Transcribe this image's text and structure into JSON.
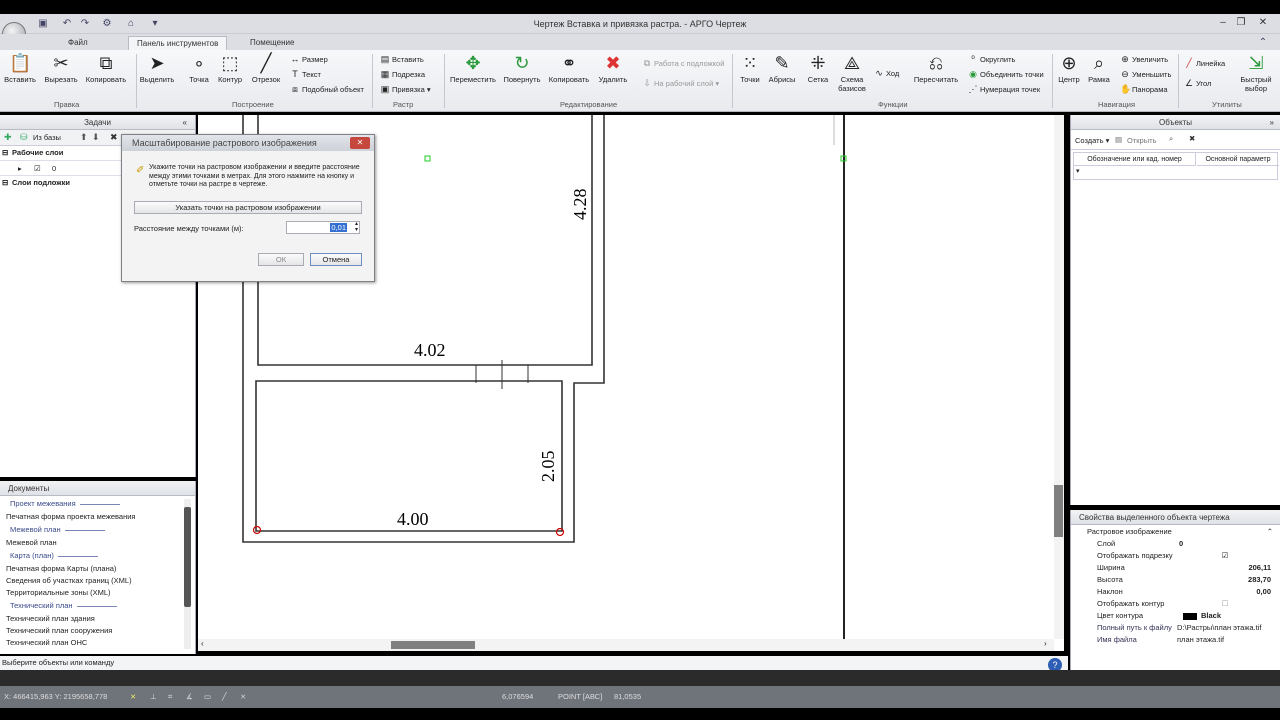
{
  "window": {
    "title": "Чертеж Вставка и привязка растра. - АРГО Чертеж"
  },
  "tabs": [
    {
      "label": "Файл"
    },
    {
      "label": "Панель инструментов"
    },
    {
      "label": "Помещение"
    }
  ],
  "ribbon": {
    "pravka": {
      "label": "Правка",
      "paste": "Вставить",
      "cut": "Вырезать",
      "copy": "Копировать"
    },
    "postroenie": {
      "label": "Построение",
      "select": "Выделить",
      "point": "Точка",
      "contour": "Контур",
      "segment": "Отрезок",
      "size": "Размер",
      "text": "Текст",
      "similar": "Подобный объект"
    },
    "raster": {
      "label": "Растр",
      "insert": "Вставить",
      "underlay": "Подрезка",
      "snap": "Привязка"
    },
    "editing": {
      "label": "Редактирование",
      "move": "Переместить",
      "rotate": "Повернуть",
      "copy": "Копировать",
      "delete": "Удалить",
      "work_underlay": "Работа с подложкой",
      "to_work_layer": "На рабочий слой"
    },
    "functions": {
      "label": "Функции",
      "points": "Точки",
      "abrises": "Абрисы",
      "grid": "Сетка",
      "schema": "Схема базисов",
      "move": "Ход",
      "recalc": "Пересчитать",
      "round": "Округлить",
      "merge": "Объединить точки",
      "numbering": "Нумерация точек"
    },
    "navigation": {
      "label": "Навигация",
      "center": "Центр",
      "frame": "Рамка",
      "zoom_in": "Увеличить",
      "zoom_out": "Уменьшить",
      "pan": "Панорама"
    },
    "utilities": {
      "label": "Утилиты",
      "ruler": "Линейка",
      "angle": "Угол",
      "quick": "Быстрый выбор"
    }
  },
  "tasks": {
    "title": "Задачи",
    "from_db": "Из базы",
    "working_layers": "Рабочие слои",
    "layer0": "0",
    "underlay_layers": "Слои подложки"
  },
  "documents": {
    "title": "Документы",
    "items": [
      {
        "kind": "group",
        "text": "Проект межевания"
      },
      {
        "kind": "item",
        "text": "Печатная форма проекта межевания"
      },
      {
        "kind": "group",
        "text": "Межевой план"
      },
      {
        "kind": "item",
        "text": "Межевой план"
      },
      {
        "kind": "group",
        "text": "Карта (план)"
      },
      {
        "kind": "item",
        "text": "Печатная форма Карты (плана)"
      },
      {
        "kind": "item",
        "text": "Сведения об участках границ (XML)"
      },
      {
        "kind": "item",
        "text": "Территориальные зоны (XML)"
      },
      {
        "kind": "group",
        "text": "Технический план"
      },
      {
        "kind": "item",
        "text": "Технический план здания"
      },
      {
        "kind": "item",
        "text": "Технический план сооружения"
      },
      {
        "kind": "item",
        "text": "Технический план ОНС"
      }
    ]
  },
  "drawing": {
    "dim1": "4.28",
    "dim2": "4.02",
    "dim3": "2.05",
    "dim4": "4.00"
  },
  "objects": {
    "title": "Объекты",
    "create": "Создать",
    "open": "Открыть",
    "col1": "Обозначение или кад. номер",
    "col2": "Основной параметр"
  },
  "properties": {
    "title": "Свойства выделенного объекта чертежа",
    "group": "Растровое изображение",
    "rows": [
      {
        "k": "Слой",
        "v": "0"
      },
      {
        "k": "Отображать подрезку",
        "v": ""
      },
      {
        "k": "Ширина",
        "v": "206,11"
      },
      {
        "k": "Высота",
        "v": "283,70"
      },
      {
        "k": "Наклон",
        "v": "0,00"
      },
      {
        "k": "Отображать контур",
        "v": ""
      },
      {
        "k": "Цвет контура",
        "v": "Black"
      },
      {
        "k": "Полный путь к файлу",
        "v": "D:\\Растры\\план этажа.tif"
      },
      {
        "k": "Имя файла",
        "v": "план этажа.tif"
      }
    ]
  },
  "dialog": {
    "title": "Масштабирование растрового изображения",
    "message": "Укажите точки на растровом изображении и введите расстояние между этими точками в метрах. Для этого нажмите на кнопку и отметьте точки на растре в чертеже.",
    "pick_button": "Указать точки на растровом изображении",
    "distance_label": "Расстояние между точками (м):",
    "distance_value": "0,01",
    "ok": "ОК",
    "cancel": "Отмена"
  },
  "status": {
    "hint": "Выберите объекты или команду",
    "coords": "X: 466415,963 Y: 2195658,778",
    "scale": "6,076594",
    "mode": "POINT [АВС]",
    "extra": "81,0535"
  }
}
